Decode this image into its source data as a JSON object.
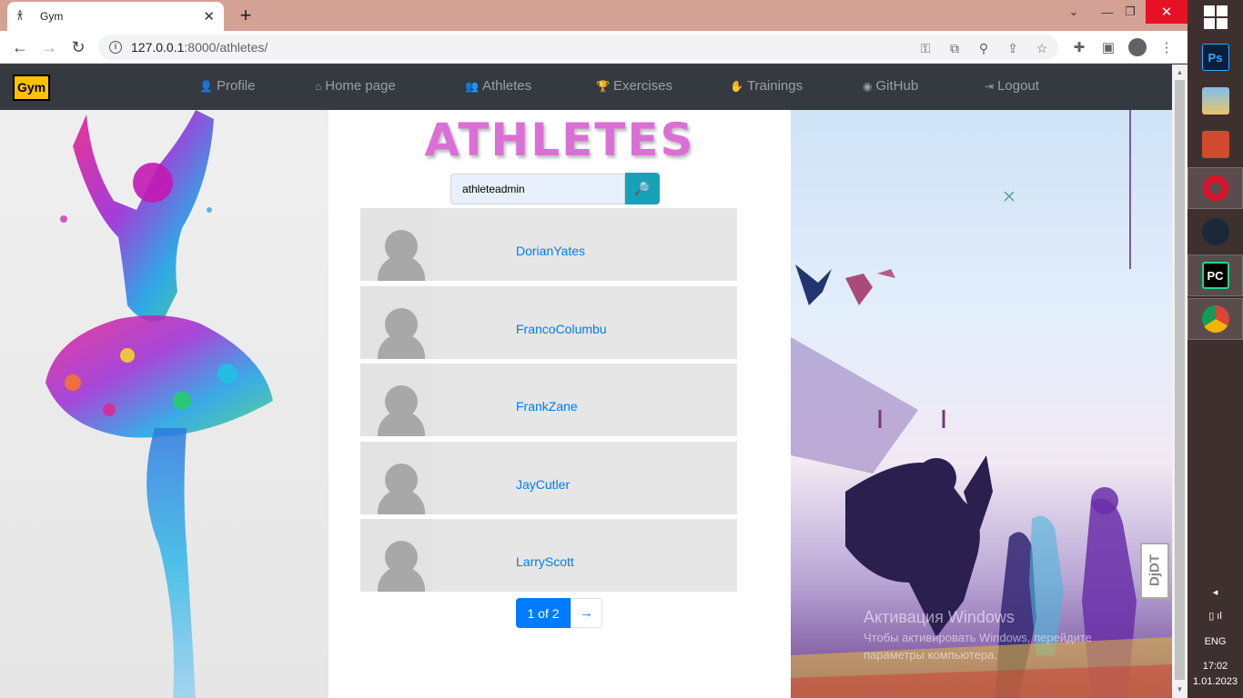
{
  "browser": {
    "tab_title": "Gym",
    "tab_close": "✕",
    "new_tab": "+",
    "url_host": "127.0.0.1",
    "url_rest": ":8000/athletes/",
    "window_controls": {
      "min": "—",
      "max": "❐",
      "close": "✕",
      "chevron": "⌄"
    }
  },
  "site": {
    "brand": "Gym",
    "nav": [
      {
        "icon": "👤",
        "label": "Profile"
      },
      {
        "icon": "⌂",
        "label": "Home page"
      },
      {
        "icon": "👥",
        "label": "Athletes"
      },
      {
        "icon": "🏆",
        "label": "Exercises"
      },
      {
        "icon": "✋",
        "label": "Trainings"
      },
      {
        "icon": "◉",
        "label": "GitHub"
      },
      {
        "icon": "⇥",
        "label": "Logout"
      }
    ]
  },
  "main": {
    "title": "ATHLETES",
    "search": {
      "value": "athleteadmin",
      "button_icon": "🔎"
    },
    "athletes": [
      {
        "name": "DorianYates"
      },
      {
        "name": "FrancoColumbu"
      },
      {
        "name": "FrankZane"
      },
      {
        "name": "JayCutler"
      },
      {
        "name": "LarryScott"
      }
    ],
    "pagination": {
      "current": "1 of 2",
      "next": "→"
    }
  },
  "overlay": {
    "activation_title": "Активация Windows",
    "activation_text_1": "Чтобы активировать Windows, перейдите",
    "activation_text_2": "параметры компьютера.",
    "djdt": "DjDT"
  },
  "taskbar": {
    "apps": [
      "Ps",
      "Photos",
      "Office",
      "Opera",
      "Steam",
      "PC",
      "Chrome"
    ],
    "lang": "ENG",
    "time": "17:02",
    "date": "1.01.2023"
  }
}
